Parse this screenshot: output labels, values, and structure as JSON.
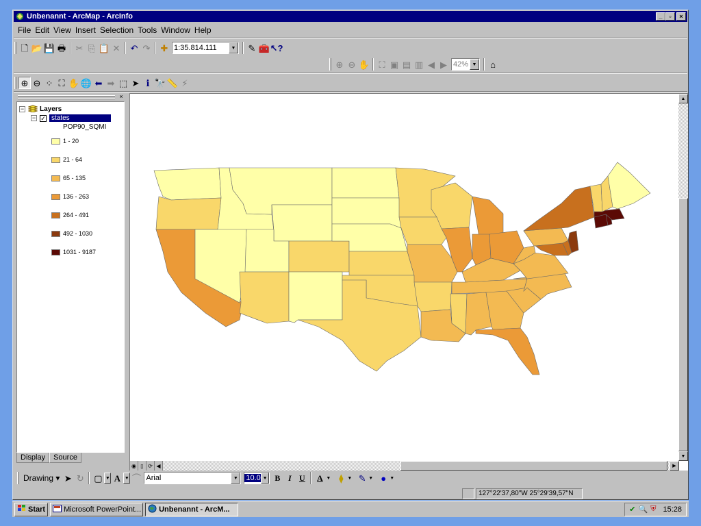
{
  "window": {
    "title": "Unbenannt - ArcMap - ArcInfo",
    "controls": [
      "_",
      "°",
      "×"
    ]
  },
  "menu": {
    "items": [
      "File",
      "Edit",
      "View",
      "Insert",
      "Selection",
      "Tools",
      "Window",
      "Help"
    ]
  },
  "standard_toolbar": {
    "scale": "1:35.814.111"
  },
  "layout_toolbar": {
    "zoom_percent": "42%"
  },
  "toc": {
    "root": "Layers",
    "layer": "states",
    "field": "POP90_SQMI",
    "legend": [
      {
        "label": "1 - 20",
        "color": "#ffffa8"
      },
      {
        "label": "21 - 64",
        "color": "#f9d76a"
      },
      {
        "label": "65 - 135",
        "color": "#f3ba52"
      },
      {
        "label": "136 - 263",
        "color": "#eb9a37"
      },
      {
        "label": "264 - 491",
        "color": "#c8701e"
      },
      {
        "label": "492 - 1030",
        "color": "#8b3a0e"
      },
      {
        "label": "1031 - 9187",
        "color": "#5b0a05"
      }
    ],
    "tabs": [
      "Display",
      "Source"
    ]
  },
  "drawing_toolbar": {
    "drawing_label": "Drawing",
    "font_name": "Arial",
    "font_size": "10.0",
    "bold": "B",
    "italic": "I",
    "underline": "U",
    "font_color": "A"
  },
  "status": {
    "coordinates": "127°22'37,80\"W  25°29'39,57\"N"
  },
  "taskbar": {
    "start": "Start",
    "items": [
      "Microsoft PowerPoint...",
      "Unbenannt - ArcM..."
    ],
    "clock": "15:28"
  }
}
